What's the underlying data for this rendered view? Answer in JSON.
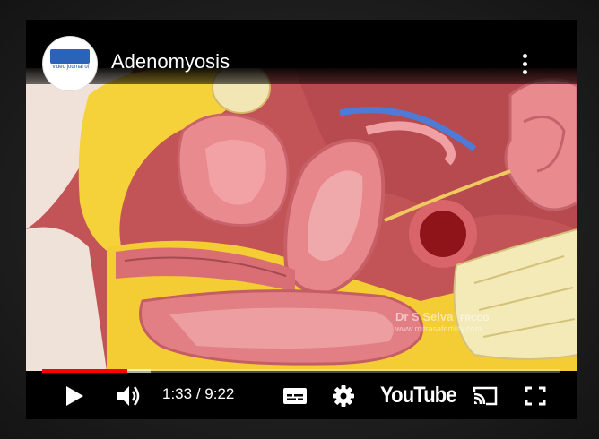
{
  "video": {
    "title": "Adenomyosis",
    "channel_logo_text": "video journal of",
    "watermark_name": "Dr S Selva",
    "watermark_suffix": "FRCOG",
    "watermark_url": "www.mitrasafertility.com"
  },
  "player": {
    "current_time": "1:33",
    "time_separator": " / ",
    "duration": "9:22",
    "progress_fraction": 0.165,
    "buffered_fraction": 0.21,
    "brand": "YouTube",
    "accent_color": "#ff0000"
  },
  "icons": {
    "play": "play-icon",
    "volume": "volume-icon",
    "captions": "subtitles-icon",
    "settings": "gear-icon",
    "cast": "cast-icon",
    "fullscreen": "fullscreen-icon",
    "more": "more-vertical-icon"
  }
}
